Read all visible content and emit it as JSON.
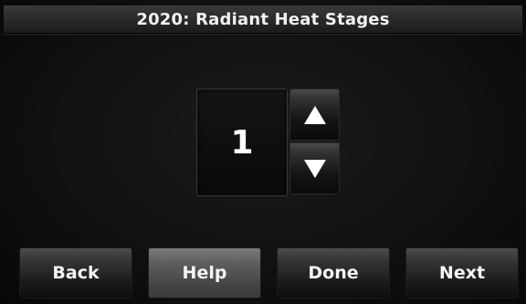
{
  "header": {
    "title": "2020: Radiant Heat Stages"
  },
  "setting": {
    "value": "1",
    "increase_icon": "triangle-up-icon",
    "decrease_icon": "triangle-down-icon"
  },
  "buttons": {
    "back_label": "Back",
    "help_label": "Help",
    "done_label": "Done",
    "next_label": "Next"
  },
  "colors": {
    "background": "#111111",
    "text": "#ffffff",
    "help_button": "#5e5e5e"
  }
}
